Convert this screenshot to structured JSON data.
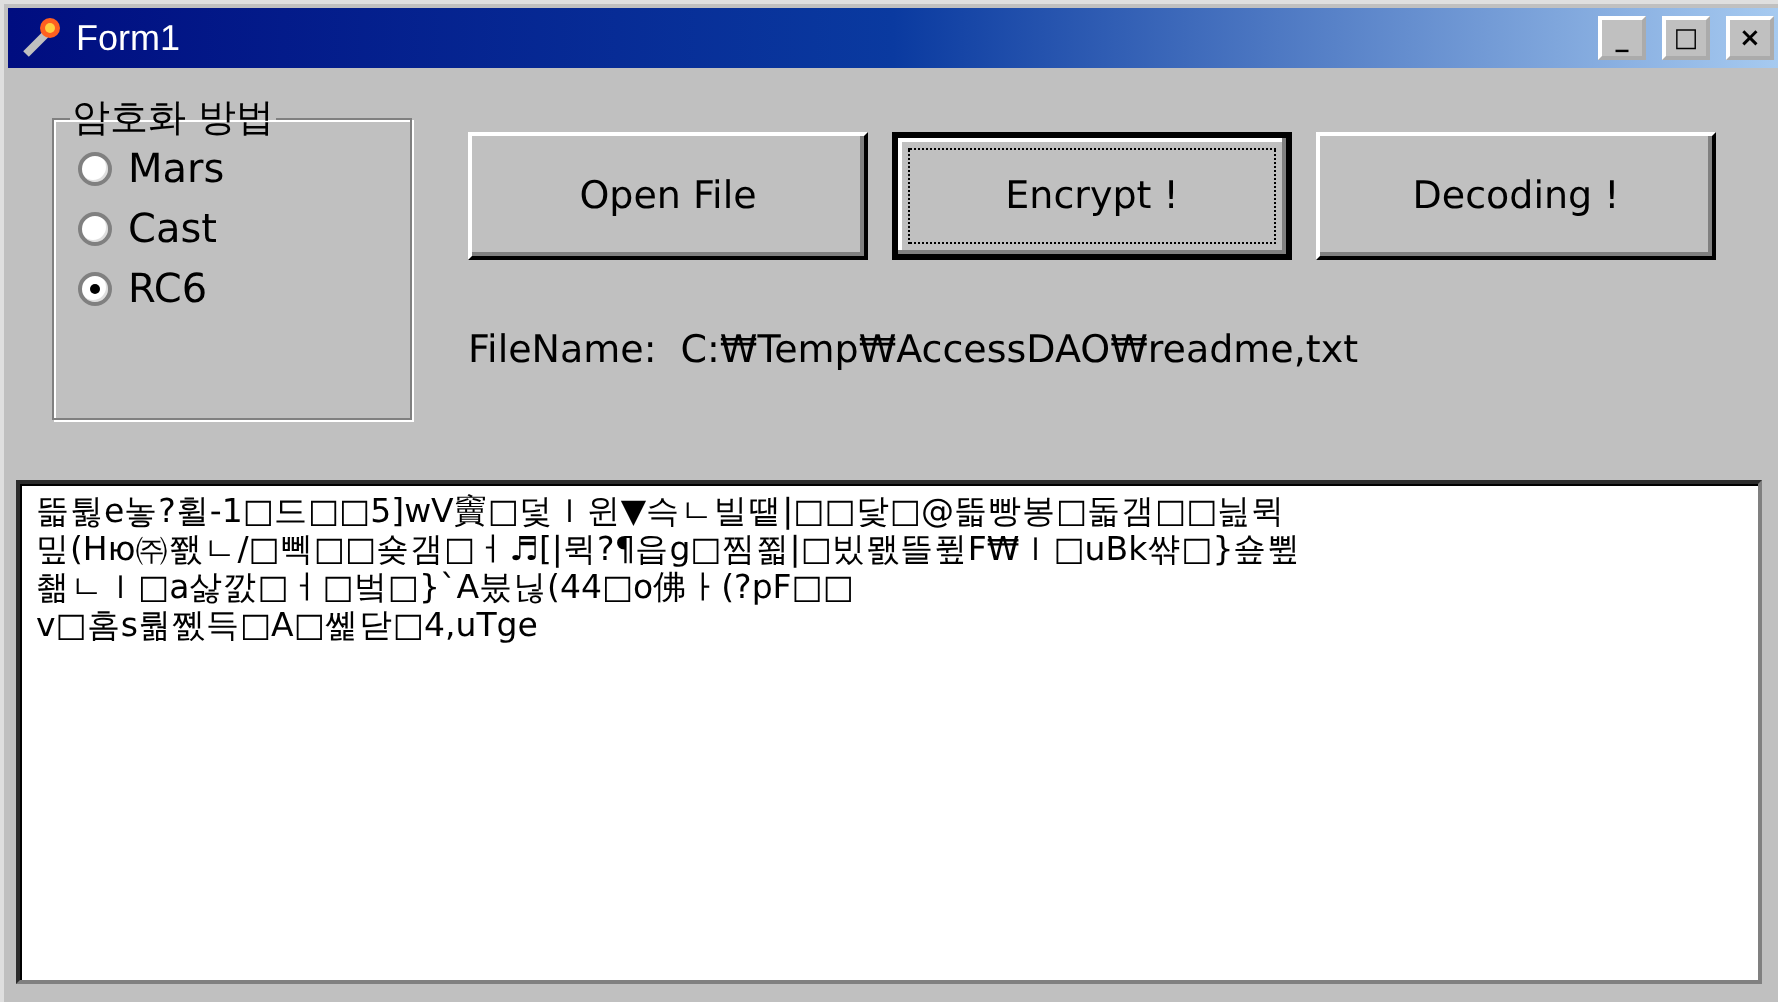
{
  "window": {
    "title": "Form1",
    "controls": [
      "_",
      "□",
      "×"
    ]
  },
  "method_group": {
    "title": "암호화 방법",
    "options": [
      {
        "label": "Mars",
        "selected": false
      },
      {
        "label": "Cast",
        "selected": false
      },
      {
        "label": "RC6",
        "selected": true
      }
    ]
  },
  "buttons": [
    {
      "label": "Open File",
      "focused": false
    },
    {
      "label": "Encrypt !",
      "focused": true
    },
    {
      "label": "Decoding !",
      "focused": false
    }
  ],
  "file_name": {
    "label": "FileName:",
    "value": "C:₩Temp₩AccessDAO₩readme,txt"
  },
  "output_lines": [
    "뜳튏e놓?휠-1□드□□5]wV竇□덫ｌ윈▼슥ㄴ빌땥|□□닻□@뜳빵봉□돏갬□□늺뮉",
    "밒(Hю㈜쬀ㄴ/□뻭□□숒갬□ㅓ♬[|뮉?¶읍g□찜쬛|□빘뫬뜰퓦F₩ｌ□uBk쌲□}숖쀺",
    "쵊ㄴｌ□a삻깘□ㅓ□벜□}`A붔닎(44□o佛ㅏ(?pF□□",
    "v□홈s뤎쪬득□A□쏉닫□4,uTge"
  ]
}
